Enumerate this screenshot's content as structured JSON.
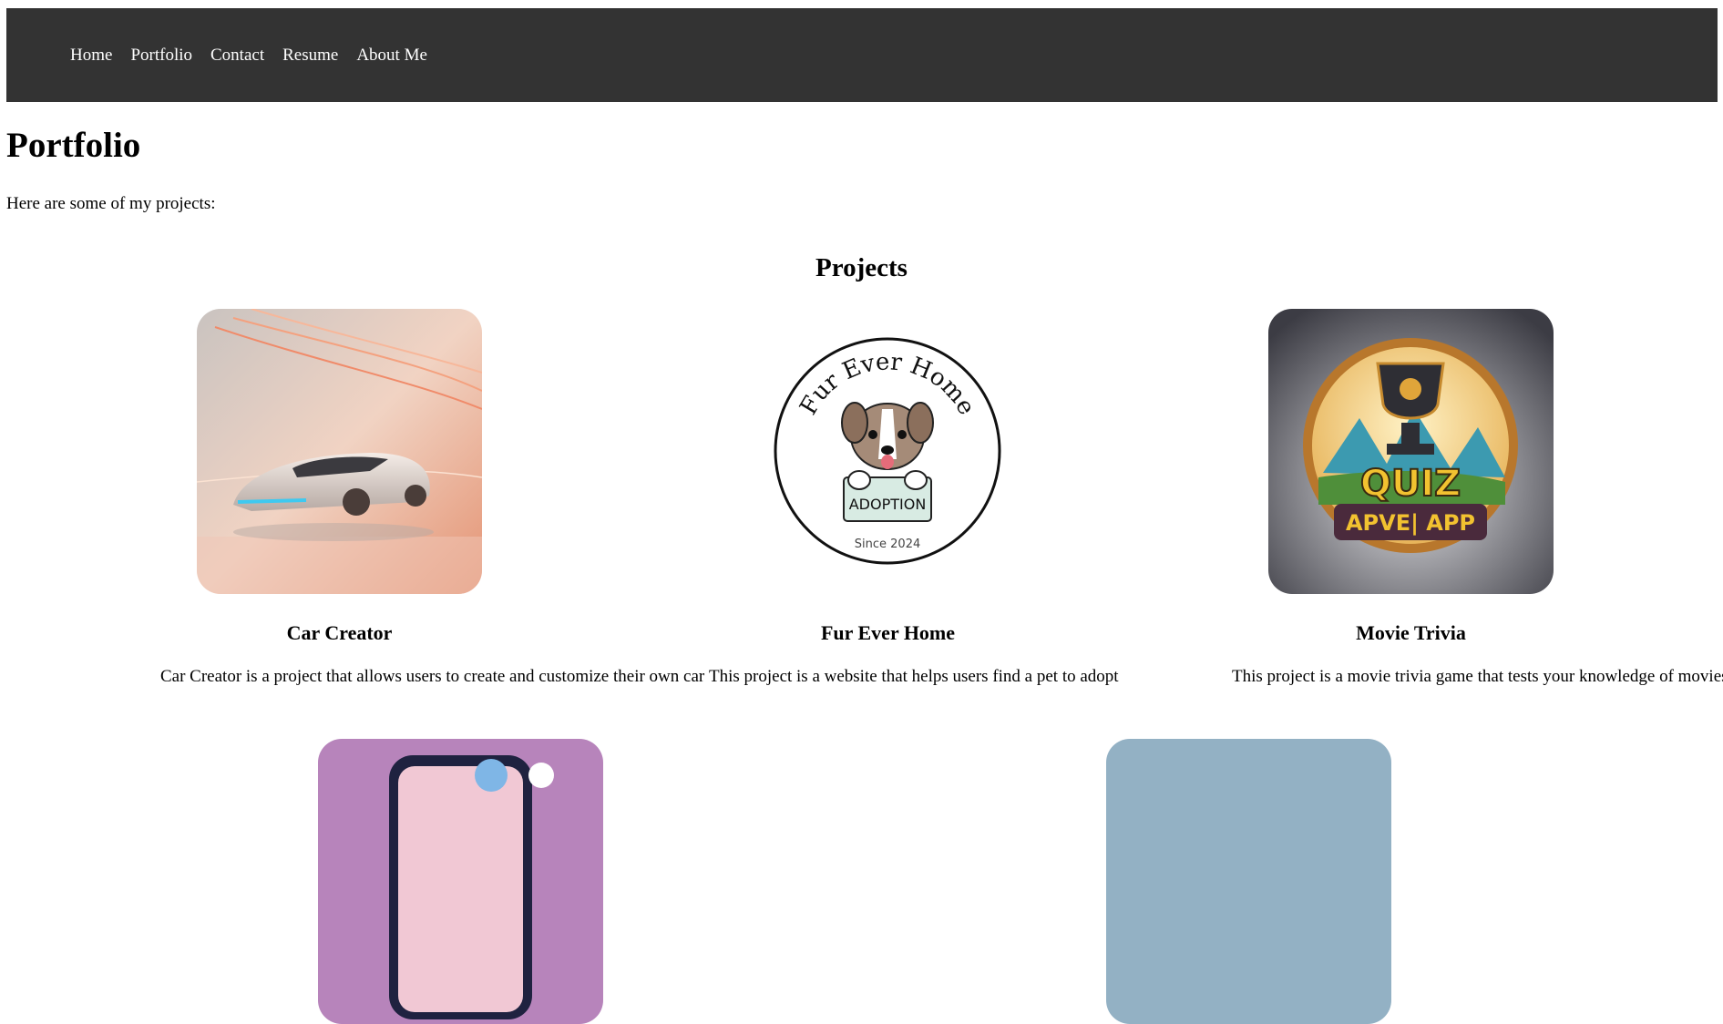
{
  "nav": {
    "items": [
      {
        "label": "Home"
      },
      {
        "label": "Portfolio"
      },
      {
        "label": "Contact"
      },
      {
        "label": "Resume"
      },
      {
        "label": "About Me"
      }
    ]
  },
  "page": {
    "title": "Portfolio",
    "intro": "Here are some of my projects:",
    "section_title": "Projects"
  },
  "projects": [
    {
      "title": "Car Creator",
      "description": "Car Creator is a project that allows users to create and customize their own car",
      "image": "futuristic-car-image"
    },
    {
      "title": "Fur Ever Home",
      "description": "This project is a website that helps users find a pet to adopt",
      "image": "puppy-adoption-logo",
      "logo_text": {
        "arc": "Fur Ever Home",
        "sign": "ADOPTION",
        "since": "Since 2024"
      }
    },
    {
      "title": "Movie Trivia",
      "description": "This project is a movie trivia game that tests your knowledge of movies",
      "image": "quiz-trophy-icon",
      "logo_text": {
        "top": "QUIZ",
        "bottom": "APVE| APP"
      }
    },
    {
      "image": "phone-app-image"
    },
    {
      "image": "blue-project-image"
    }
  ],
  "colors": {
    "navbar": "#333333",
    "nav_text": "#ffffff",
    "page_bg": "#ffffff"
  }
}
